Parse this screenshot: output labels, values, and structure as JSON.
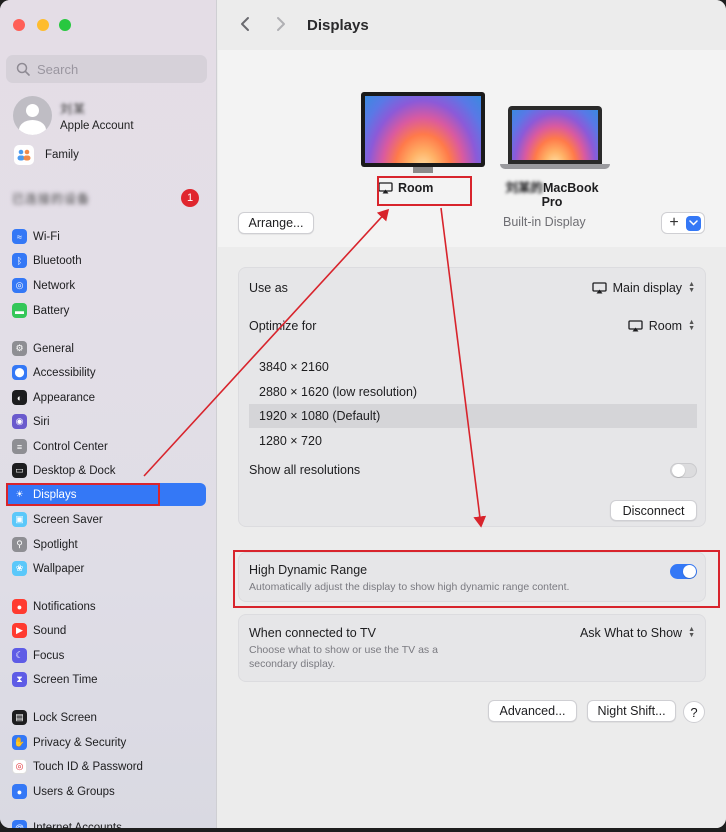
{
  "window": {
    "title": "Displays"
  },
  "sidebar": {
    "search_placeholder": "Search",
    "account": {
      "name": "刘某",
      "subtitle": "Apple Account"
    },
    "family_label": "Family",
    "blurred_label": "已连接的设备",
    "badge_count": "1",
    "items": [
      {
        "label": "Wi-Fi",
        "icon": "wifi-icon",
        "color": "#3478f6"
      },
      {
        "label": "Bluetooth",
        "icon": "bluetooth-icon",
        "color": "#3478f6"
      },
      {
        "label": "Network",
        "icon": "globe-icon",
        "color": "#3478f6"
      },
      {
        "label": "Battery",
        "icon": "battery-icon",
        "color": "#34c759"
      },
      {
        "label": "General",
        "icon": "gear-icon",
        "color": "#8e8e93"
      },
      {
        "label": "Accessibility",
        "icon": "accessibility-icon",
        "color": "#3478f6"
      },
      {
        "label": "Appearance",
        "icon": "appearance-icon",
        "color": "#1d1d1f"
      },
      {
        "label": "Siri",
        "icon": "siri-icon",
        "color": "#6a5acd"
      },
      {
        "label": "Control Center",
        "icon": "control-center-icon",
        "color": "#8e8e93"
      },
      {
        "label": "Desktop & Dock",
        "icon": "dock-icon",
        "color": "#1d1d1f"
      },
      {
        "label": "Displays",
        "icon": "sun-icon",
        "color": "#3478f6"
      },
      {
        "label": "Screen Saver",
        "icon": "screensaver-icon",
        "color": "#5ac8fa"
      },
      {
        "label": "Spotlight",
        "icon": "magnifier-icon",
        "color": "#8e8e93"
      },
      {
        "label": "Wallpaper",
        "icon": "flower-icon",
        "color": "#5ac8fa"
      },
      {
        "label": "Notifications",
        "icon": "bell-icon",
        "color": "#ff3b30"
      },
      {
        "label": "Sound",
        "icon": "speaker-icon",
        "color": "#ff3b30"
      },
      {
        "label": "Focus",
        "icon": "moon-icon",
        "color": "#5e5ce6"
      },
      {
        "label": "Screen Time",
        "icon": "hourglass-icon",
        "color": "#5e5ce6"
      },
      {
        "label": "Lock Screen",
        "icon": "lock-screen-icon",
        "color": "#1d1d1f"
      },
      {
        "label": "Privacy & Security",
        "icon": "hand-icon",
        "color": "#3478f6"
      },
      {
        "label": "Touch ID & Password",
        "icon": "fingerprint-icon",
        "color": "#ffffff"
      },
      {
        "label": "Users & Groups",
        "icon": "users-icon",
        "color": "#3478f6"
      },
      {
        "label": "Internet Accounts",
        "icon": "at-icon",
        "color": "#3478f6"
      }
    ],
    "selected": "Displays"
  },
  "main": {
    "arrange_label": "Arrange...",
    "room_label": "Room",
    "macbook_label_blurred": "刘某的",
    "macbook_label": "MacBook Pro",
    "builtin_label": "Built-in Display",
    "use_as": {
      "label": "Use as",
      "value": "Main display"
    },
    "optimize_for": {
      "label": "Optimize for",
      "value": "Room"
    },
    "resolutions": [
      "3840 × 2160",
      "2880 × 1620 (low resolution)",
      "1920 × 1080 (Default)",
      "1280 × 720"
    ],
    "selected_resolution_index": 2,
    "show_all_label": "Show all resolutions",
    "show_all_on": false,
    "disconnect_label": "Disconnect",
    "hdr": {
      "title": "High Dynamic Range",
      "description": "Automatically adjust the display to show high dynamic range content.",
      "on": true
    },
    "tv": {
      "title": "When connected to TV",
      "description": "Choose what to show or use the TV as a secondary display.",
      "value": "Ask What to Show"
    },
    "advanced_label": "Advanced...",
    "night_shift_label": "Night Shift...",
    "help_label": "?"
  },
  "colors": {
    "accent": "#3478f6",
    "annotation_red": "#d8242c"
  }
}
